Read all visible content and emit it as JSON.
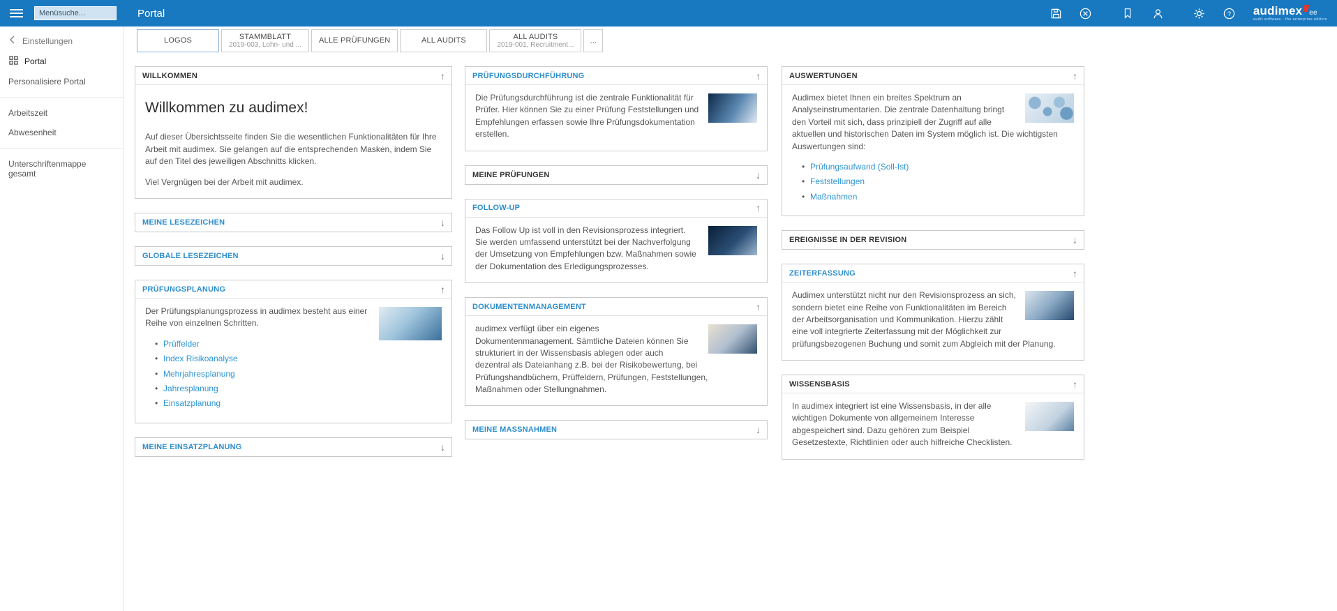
{
  "colors": {
    "topbar_blue": "#1878c0",
    "panel_title_link_blue": "#2d8dcb",
    "link_blue": "#2e95d3",
    "logo_red": "#e6372b"
  },
  "icons": {
    "up": "↑",
    "down": "↓",
    "topbar": [
      "menu-icon",
      "save-icon",
      "cancel-icon",
      "bookmark-icon",
      "user-icon",
      "settings-icon",
      "help-icon"
    ]
  },
  "topbar": {
    "title": "Portal",
    "search_placeholder": "Menüsuche...",
    "logo": {
      "brand": "audimex",
      "suffix": "ee",
      "tagline": "audit software - the enterprise edition"
    }
  },
  "sidebar": {
    "back_label": "Einstellungen",
    "items": [
      {
        "label": "Portal",
        "active": true
      },
      {
        "label": "Personalisiere Portal",
        "active": false
      },
      {
        "label": "Arbeitszeit",
        "active": false
      },
      {
        "label": "Abwesenheit",
        "active": false
      },
      {
        "label": "Unterschriftenmappe gesamt",
        "active": false
      }
    ]
  },
  "tabs": {
    "items": [
      {
        "label": "LOGOS",
        "sublabel": "",
        "active": true
      },
      {
        "label": "STAMMBLATT",
        "sublabel": "2019-003, Lohn- und ...",
        "active": false
      },
      {
        "label": "ALLE PRÜFUNGEN",
        "sublabel": "",
        "active": false
      },
      {
        "label": "ALL AUDITS",
        "sublabel": "",
        "active": false
      },
      {
        "label": "ALL AUDITS",
        "sublabel": "2019-001, Recruitment...",
        "active": false
      },
      {
        "label": "...",
        "sublabel": "",
        "active": false
      }
    ]
  },
  "panels": {
    "willkommen": {
      "title": "WILLKOMMEN",
      "expanded": true,
      "heading": "Willkommen zu audimex!",
      "p1": "Auf dieser Übersichtsseite finden Sie die wesentlichen Funktionalitäten für Ihre Arbeit mit audimex. Sie gelangen auf die entsprechenden Masken, indem Sie auf den Titel des jeweiligen Abschnitts klicken.",
      "p2": "Viel Vergnügen bei der Arbeit mit audimex."
    },
    "meine_lesezeichen": {
      "title": "MEINE LESEZEICHEN",
      "expanded": false
    },
    "globale_lesezeichen": {
      "title": "GLOBALE LESEZEICHEN",
      "expanded": false
    },
    "pruefungsplanung": {
      "title": "PRÜFUNGSPLANUNG",
      "expanded": true,
      "text": "Der Prüfungsplanungsprozess in audimex besteht aus einer Reihe von einzelnen Schritten.",
      "image": "puzzle-photo",
      "links": [
        "Prüffelder",
        "Index Risikoanalyse",
        "Mehrjahresplanung",
        "Jahresplanung",
        "Einsatzplanung"
      ]
    },
    "meine_einsatzplanung": {
      "title": "MEINE EINSATZPLANUNG",
      "expanded": false
    },
    "pruefungsdurchfuehrung": {
      "title": "PRÜFUNGSDURCHFÜHRUNG",
      "expanded": true,
      "text": "Die Prüfungsdurchführung ist die zentrale Funktionalität für Prüfer. Hier können Sie zu einer Prüfung Feststellungen und Empfehlungen erfassen sowie Ihre Prüfungsdokumentation erstellen.",
      "image": "pen-photo"
    },
    "meine_pruefungen": {
      "title": "MEINE PRÜFUNGEN",
      "expanded": false
    },
    "follow_up": {
      "title": "FOLLOW-UP",
      "expanded": true,
      "text": "Das Follow Up ist voll in den Revisionsprozess integriert. Sie werden umfassend unterstützt bei der Nachverfolgung der Umsetzung von Empfehlungen bzw. Maßnahmen sowie der Dokumentation des Erledigungsprozesses.",
      "image": "hand-photo"
    },
    "dokumentenmanagement": {
      "title": "DOKUMENTENMANAGEMENT",
      "expanded": true,
      "text": "audimex verfügt über ein eigenes Dokumentenmanagement. Sämtliche Dateien können Sie strukturiert in der Wissensbasis ablegen oder auch dezentral als Dateianhang z.B. bei der Risikobewertung, bei Prüfungshandbüchern, Prüffeldern, Prüfungen, Feststellungen, Maßnahmen oder Stellungnahmen.",
      "image": "pencils-photo"
    },
    "meine_massnahmen": {
      "title": "MEINE MASSNAHMEN",
      "expanded": false
    },
    "auswertungen": {
      "title": "AUSWERTUNGEN",
      "expanded": true,
      "text": "Audimex bietet Ihnen ein breites Spektrum an Analyseinstrumentarien. Die zentrale Datenhaltung bringt den Vorteil mit sich, dass prinzipiell der Zugriff auf alle aktuellen und historischen Daten im System möglich ist. Die wichtigsten Auswertungen sind:",
      "image": "pills-photo",
      "links": [
        "Prüfungsaufwand (Soll-Ist)",
        "Feststellungen",
        "Maßnahmen"
      ]
    },
    "ereignisse": {
      "title": "EREIGNISSE IN DER REVISION",
      "expanded": false
    },
    "zeiterfassung": {
      "title": "ZEITERFASSUNG",
      "expanded": true,
      "text": "Audimex unterstützt nicht nur den Revisionsprozess an sich, sondern bietet eine Reihe von Funktionalitäten im Bereich der Arbeitsorganisation und Kommunikation. Hierzu zählt eine voll integrierte Zeiterfassung mit der Möglichkeit zur prüfungsbezogenen Buchung und somit zum Abgleich mit der Planung.",
      "image": "calculator-photo"
    },
    "wissensbasis": {
      "title": "WISSENSBASIS",
      "expanded": true,
      "text": "In audimex integriert ist eine Wissensbasis, in der alle wichtigen Dokumente von allgemeinem Interesse abgespeichert sind. Dazu gehören zum Beispiel Gesetzestexte, Richtlinien oder auch hilfreiche Checklisten.",
      "image": "pen-paper-photo"
    }
  }
}
